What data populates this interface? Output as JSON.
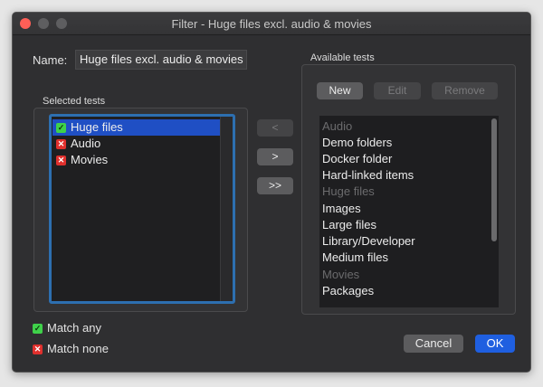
{
  "window": {
    "title": "Filter - Huge files excl. audio & movies"
  },
  "name": {
    "label": "Name:",
    "value": "Huge files excl. audio & movies"
  },
  "selected": {
    "heading": "Selected tests",
    "items": [
      {
        "label": "Huge files",
        "state": "check",
        "selected": true
      },
      {
        "label": "Audio",
        "state": "cross",
        "selected": false
      },
      {
        "label": "Movies",
        "state": "cross",
        "selected": false
      }
    ]
  },
  "move_buttons": {
    "remove": "<",
    "add": ">",
    "add_all": ">>"
  },
  "available": {
    "heading": "Available tests",
    "new_label": "New",
    "edit_label": "Edit",
    "remove_label": "Remove",
    "items": [
      {
        "label": "Audio",
        "enabled": false
      },
      {
        "label": "Demo folders",
        "enabled": true
      },
      {
        "label": "Docker folder",
        "enabled": true
      },
      {
        "label": "Hard-linked items",
        "enabled": true
      },
      {
        "label": "Huge files",
        "enabled": false
      },
      {
        "label": "Images",
        "enabled": true
      },
      {
        "label": "Large files",
        "enabled": true
      },
      {
        "label": "Library/Developer",
        "enabled": true
      },
      {
        "label": "Medium files",
        "enabled": true
      },
      {
        "label": "Movies",
        "enabled": false
      },
      {
        "label": "Packages",
        "enabled": true
      }
    ]
  },
  "match": {
    "any_label": "Match any",
    "none_label": "Match none"
  },
  "footer": {
    "cancel_label": "Cancel",
    "ok_label": "OK"
  },
  "icons": {
    "check": "check-icon",
    "cross": "cross-icon"
  },
  "colors": {
    "accent": "#1f5fe0",
    "check": "#3fd14a",
    "cross": "#e0302d",
    "selection": "#1f4fc4"
  }
}
